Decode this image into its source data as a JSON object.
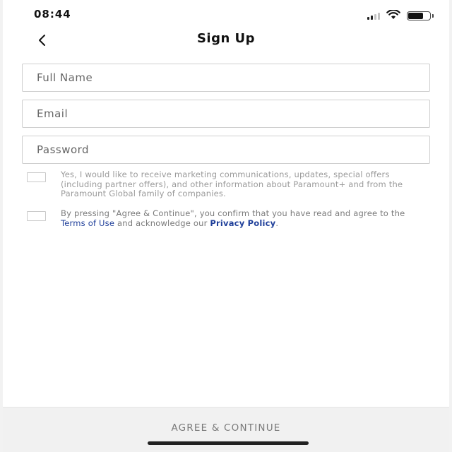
{
  "status_bar": {
    "time": "08:44",
    "icons": [
      "cellular-signal-icon",
      "wifi-icon",
      "battery-icon"
    ]
  },
  "nav": {
    "back_icon": "chevron-left-icon",
    "title": "Sign Up"
  },
  "form": {
    "full_name": {
      "placeholder": "Full Name",
      "value": ""
    },
    "email": {
      "placeholder": "Email",
      "value": ""
    },
    "password": {
      "placeholder": "Password",
      "value": ""
    }
  },
  "consents": {
    "marketing": {
      "checked": false,
      "text": "Yes, I would like to receive marketing communications, updates, special offers (including partner offers), and other information about Paramount+ and from the Paramount Global family of companies."
    },
    "terms": {
      "checked": false,
      "text_before": "By pressing \"Agree & Continue\", you confirm that you have read and agree to the ",
      "terms_link": "Terms of Use",
      "text_middle": " and acknowledge our ",
      "privacy_link": "Privacy Policy",
      "text_after": "."
    }
  },
  "footer": {
    "agree_label": "AGREE & CONTINUE"
  },
  "colors": {
    "link": "#1f3f9a",
    "footer_bg": "#f1f1f1",
    "disabled_text": "#7a7a7a"
  }
}
